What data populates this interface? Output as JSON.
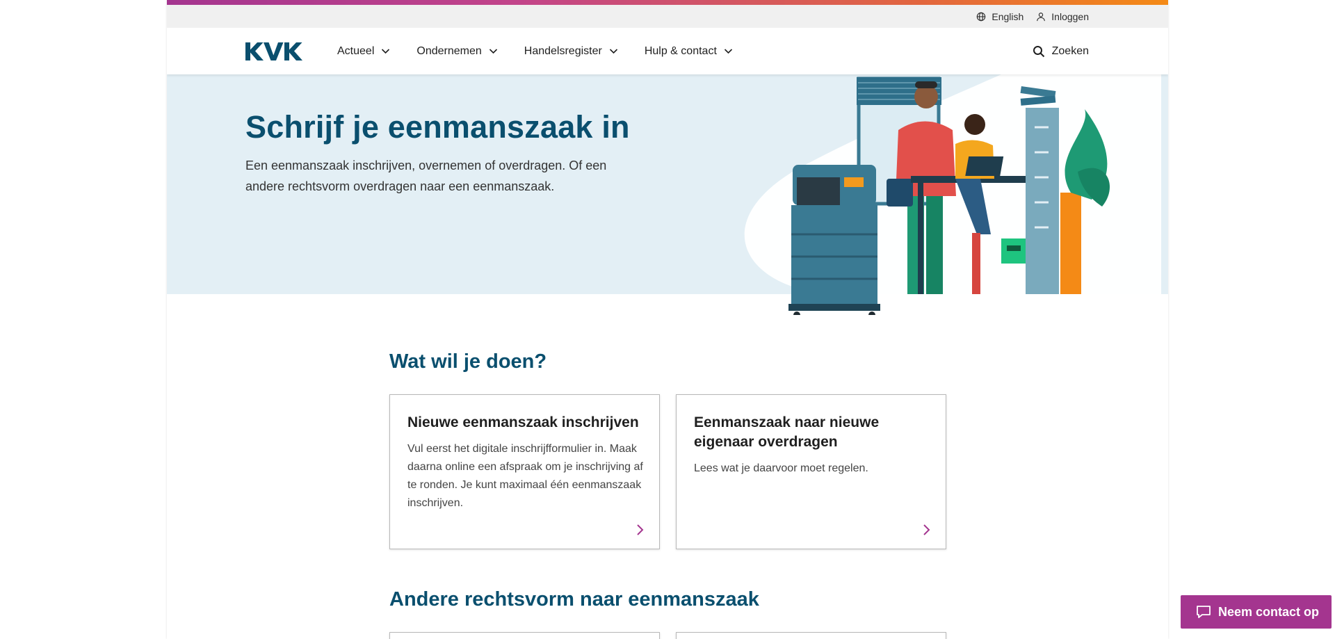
{
  "topbar": {
    "language_label": "English",
    "login_label": "Inloggen"
  },
  "nav": {
    "logo_text": "KVK",
    "items": [
      {
        "label": "Actueel"
      },
      {
        "label": "Ondernemen"
      },
      {
        "label": "Handelsregister"
      },
      {
        "label": "Hulp & contact"
      }
    ],
    "search_label": "Zoeken"
  },
  "hero": {
    "title": "Schrijf je eenmanszaak in",
    "text": "Een eenmanszaak inschrijven, overnemen of overdragen. Of een andere rechtsvorm overdragen naar een eenmanszaak."
  },
  "section1": {
    "title": "Wat wil je doen?",
    "cards": [
      {
        "title": "Nieuwe eenmanszaak inschrijven",
        "text": "Vul eerst het digitale inschrijfformulier in. Maak daarna online een afspraak om je inschrijving af te ronden. Je kunt maximaal één eenmanszaak inschrijven."
      },
      {
        "title": "Eenmanszaak naar nieuwe eigenaar overdragen",
        "text": "Lees wat je daarvoor moet regelen."
      }
    ]
  },
  "section2": {
    "title": "Andere rechtsvorm naar eenmanszaak"
  },
  "contact_button": {
    "label": "Neem contact op"
  },
  "colors": {
    "brand_blue": "#0a4f6e",
    "accent_purple": "#a4358f",
    "hero_bg": "#e3eff5"
  }
}
